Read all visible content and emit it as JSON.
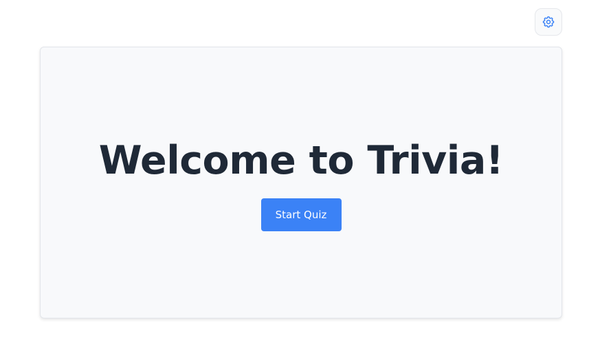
{
  "header": {
    "settings_icon": "gear-icon"
  },
  "main": {
    "title": "Welcome to Trivia!",
    "start_button_label": "Start Quiz"
  },
  "colors": {
    "accent": "#3b82f6",
    "title": "#1f2937",
    "card_background": "#f8f9fb",
    "icon": "#3b82f6"
  }
}
